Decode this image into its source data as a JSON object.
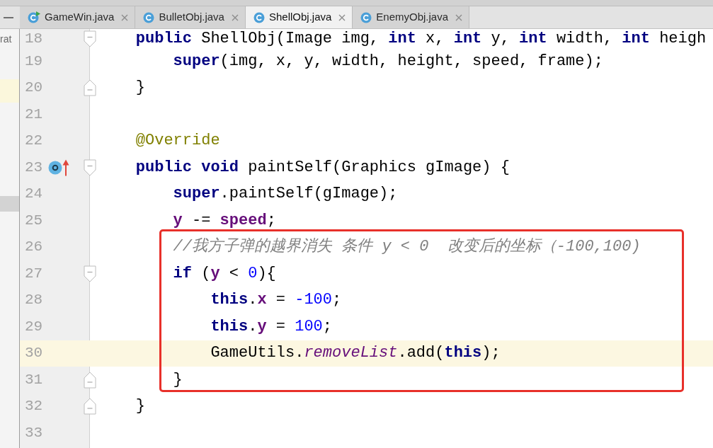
{
  "project_panel": {
    "text": "rat"
  },
  "tabs": [
    {
      "label": "GameWin.java",
      "selected": false,
      "kind": "runnable"
    },
    {
      "label": "BulletObj.java",
      "selected": false,
      "kind": "class"
    },
    {
      "label": "ShellObj.java",
      "selected": true,
      "kind": "class"
    },
    {
      "label": "EnemyObj.java",
      "selected": false,
      "kind": "class"
    }
  ],
  "editor": {
    "lines": [
      {
        "number": "18",
        "tokens": [
          {
            "text": "public",
            "kind": "keyword"
          },
          {
            "text": " ShellObj(Image img, ",
            "kind": "plain"
          },
          {
            "text": "int",
            "kind": "keyword"
          },
          {
            "text": " x, ",
            "kind": "plain"
          },
          {
            "text": "int",
            "kind": "keyword"
          },
          {
            "text": " y, ",
            "kind": "plain"
          },
          {
            "text": "int",
            "kind": "keyword"
          },
          {
            "text": " width, ",
            "kind": "plain"
          },
          {
            "text": "int",
            "kind": "keyword"
          },
          {
            "text": " heigh",
            "kind": "plain"
          }
        ],
        "current": false,
        "fold_marker": {
          "kind": "start"
        },
        "children": [
          {
            "number": "19",
            "tokens": [
              {
                "text": "super",
                "kind": "keyword"
              },
              {
                "text": "(img, x, y, width, height, speed, frame);",
                "kind": "plain"
              }
            ],
            "current": false
          }
        ]
      },
      {
        "number": "20",
        "tokens": [
          {
            "text": "}",
            "kind": "plain"
          }
        ],
        "current": false,
        "fold_marker": {
          "kind": "end"
        }
      },
      {
        "number": "21",
        "current": false
      },
      {
        "number": "22",
        "tokens": [
          {
            "text": "@Override",
            "kind": "annotation"
          }
        ],
        "current": false
      },
      {
        "number": "23",
        "tokens": [
          {
            "text": "public void",
            "kind": "keyword"
          },
          {
            "text": " paintSelf(Graphics gImage) {",
            "kind": "plain"
          }
        ],
        "current": false,
        "fold_marker": {
          "kind": "start"
        },
        "gutter_icons": [
          {
            "kind": "ring"
          },
          {
            "kind": "arrow"
          }
        ],
        "children": [
          {
            "kind": "line",
            "number": "24",
            "tokens": [
              {
                "text": "super",
                "kind": "keyword"
              },
              {
                "text": ".paintSelf(gImage);",
                "kind": "plain"
              }
            ],
            "current": false
          },
          {
            "kind": "line",
            "number": "25",
            "tokens": [
              {
                "text": "y",
                "kind": "field"
              },
              {
                "text": " -= ",
                "kind": "plain"
              },
              {
                "text": "speed",
                "kind": "field"
              },
              {
                "text": ";",
                "kind": "plain"
              }
            ],
            "current": false
          },
          {
            "kind": "annotation_frame",
            "lines": [
              {
                "number": "26",
                "tokens": [
                  {
                    "text": "//我方子弹的越界消失 条件 y < 0  改变后的坐标（-100,100)",
                    "kind": "comment"
                  }
                ],
                "current": false
              },
              {
                "number": "27",
                "tokens": [
                  {
                    "text": "if",
                    "kind": "keyword"
                  },
                  {
                    "text": " (",
                    "kind": "plain"
                  },
                  {
                    "text": "y",
                    "kind": "field"
                  },
                  {
                    "text": " < ",
                    "kind": "plain"
                  },
                  {
                    "text": "0",
                    "kind": "number"
                  },
                  {
                    "text": "){",
                    "kind": "plain"
                  }
                ],
                "current": false,
                "fold_marker": {
                  "kind": "start"
                },
                "children": [
                  {
                    "number": "28",
                    "tokens": [
                      {
                        "text": "this",
                        "kind": "keyword"
                      },
                      {
                        "text": ".",
                        "kind": "plain"
                      },
                      {
                        "text": "x",
                        "kind": "field"
                      },
                      {
                        "text": " = ",
                        "kind": "plain"
                      },
                      {
                        "text": "-100",
                        "kind": "number"
                      },
                      {
                        "text": ";",
                        "kind": "plain"
                      }
                    ],
                    "current": false
                  },
                  {
                    "number": "29",
                    "tokens": [
                      {
                        "text": "this",
                        "kind": "keyword"
                      },
                      {
                        "text": ".",
                        "kind": "plain"
                      },
                      {
                        "text": "y",
                        "kind": "field"
                      },
                      {
                        "text": " = ",
                        "kind": "plain"
                      },
                      {
                        "text": "100",
                        "kind": "number"
                      },
                      {
                        "text": ";",
                        "kind": "plain"
                      }
                    ],
                    "current": false
                  },
                  {
                    "number": "30",
                    "tokens": [
                      {
                        "text": "GameUtils.",
                        "kind": "plain"
                      },
                      {
                        "text": "removeList",
                        "kind": "static"
                      },
                      {
                        "text": ".add(",
                        "kind": "plain"
                      },
                      {
                        "text": "this",
                        "kind": "keyword"
                      },
                      {
                        "text": ");",
                        "kind": "plain"
                      }
                    ],
                    "current": true
                  }
                ]
              },
              {
                "number": "31",
                "tokens": [
                  {
                    "text": "}",
                    "kind": "plain"
                  }
                ],
                "current": false,
                "fold_marker": {
                  "kind": "end"
                }
              }
            ]
          }
        ]
      },
      {
        "number": "32",
        "tokens": [
          {
            "text": "}",
            "kind": "plain"
          }
        ],
        "current": false,
        "fold_marker": {
          "kind": "end"
        }
      },
      {
        "number": "33",
        "current": false
      }
    ]
  }
}
